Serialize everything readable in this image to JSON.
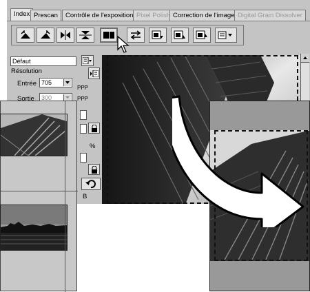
{
  "tabs": [
    {
      "label": "Index",
      "state": "active"
    },
    {
      "label": "Prescan",
      "state": "normal"
    },
    {
      "label": "Contrôle de l'exposition",
      "state": "normal"
    },
    {
      "label": "Pixel Polish",
      "state": "disabled"
    },
    {
      "label": "Correction de l'image",
      "state": "normal"
    },
    {
      "label": "Digital Grain Dissolver",
      "state": "disabled"
    }
  ],
  "toolbar": {
    "icons": [
      "rotate-left-icon",
      "rotate-right-icon",
      "flip-horizontal-icon",
      "flip-vertical-icon",
      "split-compare-icon",
      "swap-arrows-icon",
      "settings-load-icon",
      "settings-save-icon",
      "settings-apply-icon",
      "menu-dropdown-icon"
    ]
  },
  "settings": {
    "preset_value": "Défaut",
    "resolution_label": "Résolution",
    "input_label": "Entrée",
    "input_value": "705",
    "input_unit": "PPP",
    "output_label": "Sortie",
    "output_value": "300",
    "output_unit": "PPP",
    "percent_label": "%",
    "b_label": "B"
  },
  "colors": {
    "window_bg": "#c4c4c4",
    "arrow_fill": "#ffffff",
    "arrow_stroke": "#000000"
  }
}
